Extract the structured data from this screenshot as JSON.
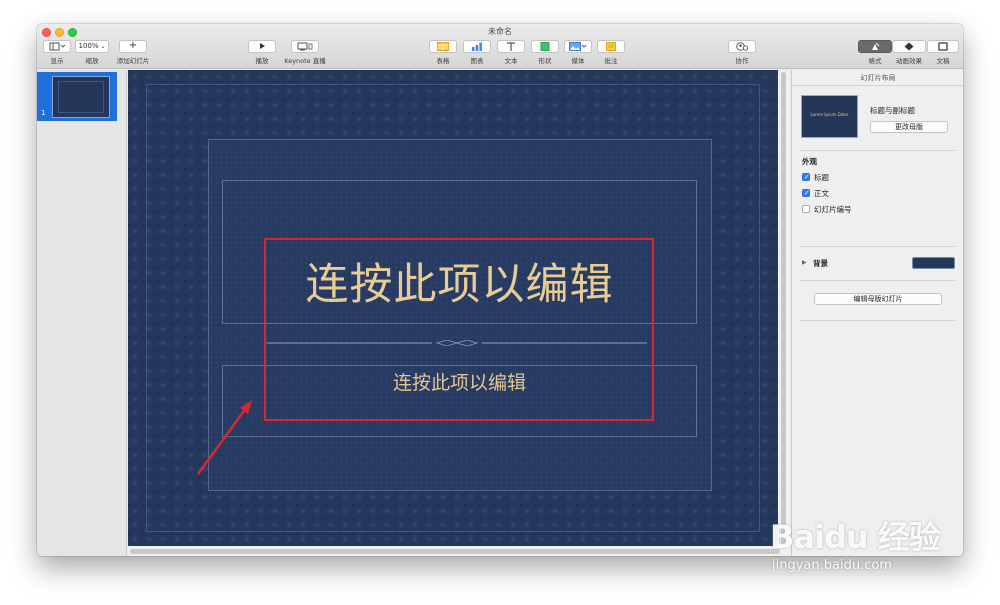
{
  "window": {
    "title": "未命名"
  },
  "toolbar": {
    "view_label": "显示",
    "zoom_value": "100%",
    "zoom_label": "缩放",
    "add_slide_label": "添加幻灯片",
    "play_label": "播放",
    "keynote_live_label": "Keynote 直播",
    "table_label": "表格",
    "chart_label": "图表",
    "text_label": "文本",
    "shape_label": "形状",
    "media_label": "媒体",
    "comment_label": "批注",
    "collaborate_label": "协作",
    "format_label": "格式",
    "animate_label": "动画效果",
    "document_label": "文稿"
  },
  "sidebar": {
    "slides": [
      {
        "number": "1"
      }
    ]
  },
  "slide": {
    "title": "连按此项以编辑",
    "subtitle": "连按此项以编辑"
  },
  "inspector": {
    "header": "幻灯片布局",
    "master_thumb_text": "Lorem Ipsum Dolor",
    "master_name": "标题与副标题",
    "change_master": "更改母版",
    "appearance_heading": "外观",
    "checkboxes": [
      {
        "label": "标题",
        "checked": true
      },
      {
        "label": "正文",
        "checked": true
      },
      {
        "label": "幻灯片编号",
        "checked": false
      }
    ],
    "background_label": "背景",
    "background_color": "#24375c",
    "edit_master_button": "编辑母版幻灯片"
  },
  "watermark": {
    "logo_text": "Baidu 经验",
    "url": "jingyan.baidu.com"
  },
  "colors": {
    "accent_blue": "#1f6fdc",
    "highlight_red": "#d9262f",
    "slide_text_gold": "#e8cc94"
  }
}
